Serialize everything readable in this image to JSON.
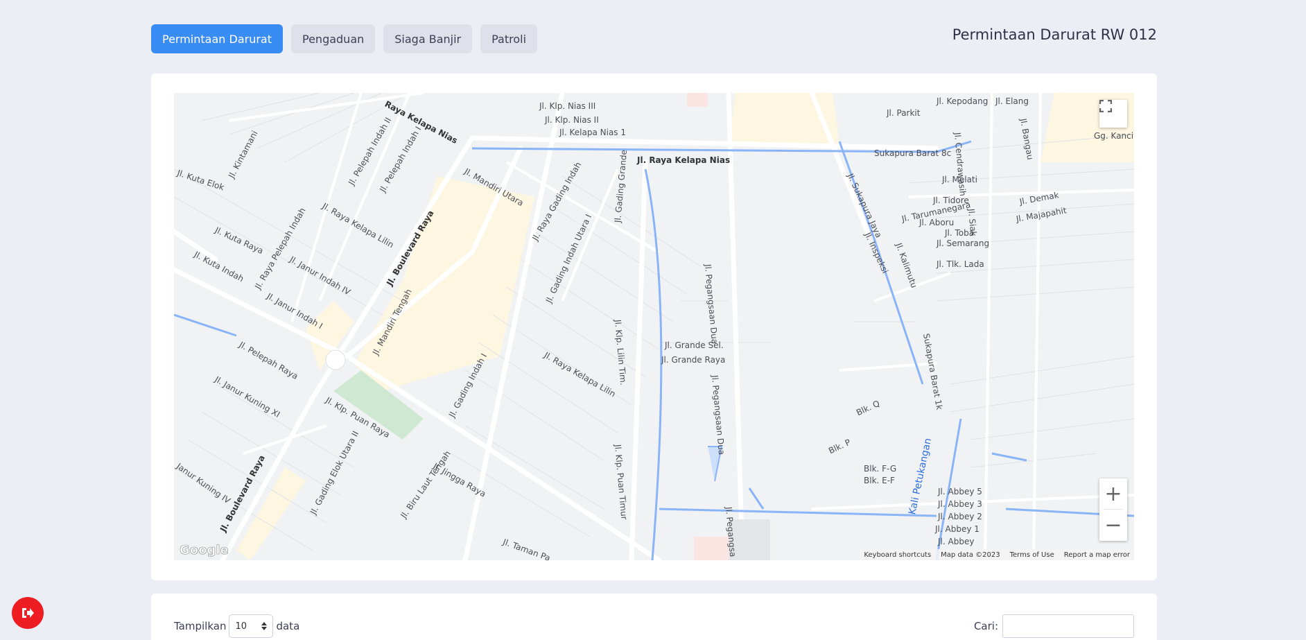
{
  "tabs": [
    {
      "label": "Permintaan Darurat",
      "active": true
    },
    {
      "label": "Pengaduan",
      "active": false
    },
    {
      "label": "Siaga Banjir",
      "active": false
    },
    {
      "label": "Patroli",
      "active": false
    }
  ],
  "page_title": "Permintaan Darurat RW 012",
  "map": {
    "labels": {
      "raya_kelapa_nias_top": "Raya Kelapa Nias",
      "klp_nias_iii": "Jl. Klp. Nias III",
      "klp_nias_ii": "Jl. Klp. Nias II",
      "kelapa_nias_1": "Jl. Kelapa Nias 1",
      "raya_kelapa_nias": "Jl. Raya Kelapa Nias",
      "kintamani": "Jl. Kintamani",
      "kuta_elok": "Jl. Kuta Elok",
      "kuta_raya": "Jl. Kuta Raya",
      "kuta_indah": "Jl. Kuta Indah",
      "raya_pelepah_indah": "Jl. Raya Pelepah Indah",
      "pelepah_indah_ii": "Jl. Pelepah Indah II",
      "pelepah_indah_i": "Jl. Pelepah Indah I",
      "raya_kelapa_lilin": "Jl. Raya Kelapa Lilin",
      "boulevard_raya": "Jl. Boulevard Raya",
      "mandiri_utara": "Jl. Mandiri Utara",
      "raya_gading_indah": "Jl. Raya Gading Indah",
      "gading_indah_utara_i": "Jl. Gading Indah Utara I",
      "janur_indah_iv": "Jl. Janur Indah IV",
      "janur_indah_i": "Jl. Janur Indah I",
      "pelepah_raya": "Jl. Pelepah Raya",
      "janur_kuning_xi": "Jl. Janur Kuning XI",
      "klp_puan_raya": "Jl. Klp. Puan Raya",
      "mandiri_tengah": "Jl. Mandiri Tengah",
      "gading_indah_i": "Jl. Gading Indah I",
      "raya_kelapa_lilin_2": "Jl. Raya Kelapa Lilin",
      "jingga_raya": "Jl. Jingga Raya",
      "gading_elok_utara_ii": "Jl. Gading Elok Utara II",
      "biru_laut_tengah": "Jl. Biru Laut Tengah",
      "taman_pa": "Jl. Taman Pa",
      "janur_kuning_iv": "Janur Kuning IV",
      "boulevard_raya_2": "Jl. Boulevard Raya",
      "gading_grande": "Jl. Gading Grande",
      "klp_lilin_timur": "Jl. Klp. Lilin Tim.",
      "klp_puan_timur": "Jl. Klp. Puan Timur",
      "grande_sel": "Jl. Grande Sel.",
      "grande_raya": "Jl. Grande Raya",
      "pegangsaan_dua": "Jl. Pegangsaan Dua",
      "pegangsaan_dua_2": "Jl. Pegangsaan Dua",
      "pegangsaan": "Jl. Pegangsa",
      "kepodang": "Jl. Kepodang",
      "elang": "Jl. Elang",
      "parkit": "Jl. Parkit",
      "sukapura_barat_8c": "Sukapura Barat 8c",
      "melati": "Jl. Melati",
      "tidore": "Jl. Tidore",
      "tarumanegara": "Jl. Tarumanegara",
      "aboru": "Jl. Aboru",
      "toba": "Jl. Toba",
      "semarang": "Jl. Semarang",
      "tlk_lada": "Jl. Tlk. Lada",
      "demak": "Jl. Demak",
      "majapahit": "Jl. Majapahit",
      "gg_kancil": "Gg. Kanci",
      "sukapura_jaya": "Jl. Sukapura Jaya",
      "inspeksi": "Jl. Inspeksi",
      "kalimutu": "Jl. Kalimutu",
      "sukapura_barat_1k": "Sukapura Barat 1k",
      "blk_q": "Blk. Q",
      "blk_p": "Blk. P",
      "blk_fg": "Blk. F-G",
      "blk_ef": "Blk. E-F",
      "kali_petukangan": "Kali Petukangan",
      "abbey_5": "Jl. Abbey 5",
      "abbey_3": "Jl. Abbey 3",
      "abbey_2": "Jl. Abbey 2",
      "abbey_1": "Jl. Abbey 1",
      "abbey": "Jl. Abbey",
      "cendrawasih": "Jl. Cendrawasih",
      "bangau": "Jl. Bangau",
      "siak": "Jl. Siak"
    },
    "zoom_in": "+",
    "zoom_out": "−",
    "google_logo": "Google",
    "attribution": {
      "keyboard": "Keyboard shortcuts",
      "map_data": "Map data ©2023",
      "terms": "Terms of Use",
      "report": "Report a map error"
    }
  },
  "table_controls": {
    "show_label": "Tampilkan",
    "page_length": "10",
    "data_label": "data",
    "search_label": "Cari:",
    "search_value": ""
  },
  "colors": {
    "accent": "#3a8cf5",
    "logout": "#ee1d24"
  }
}
